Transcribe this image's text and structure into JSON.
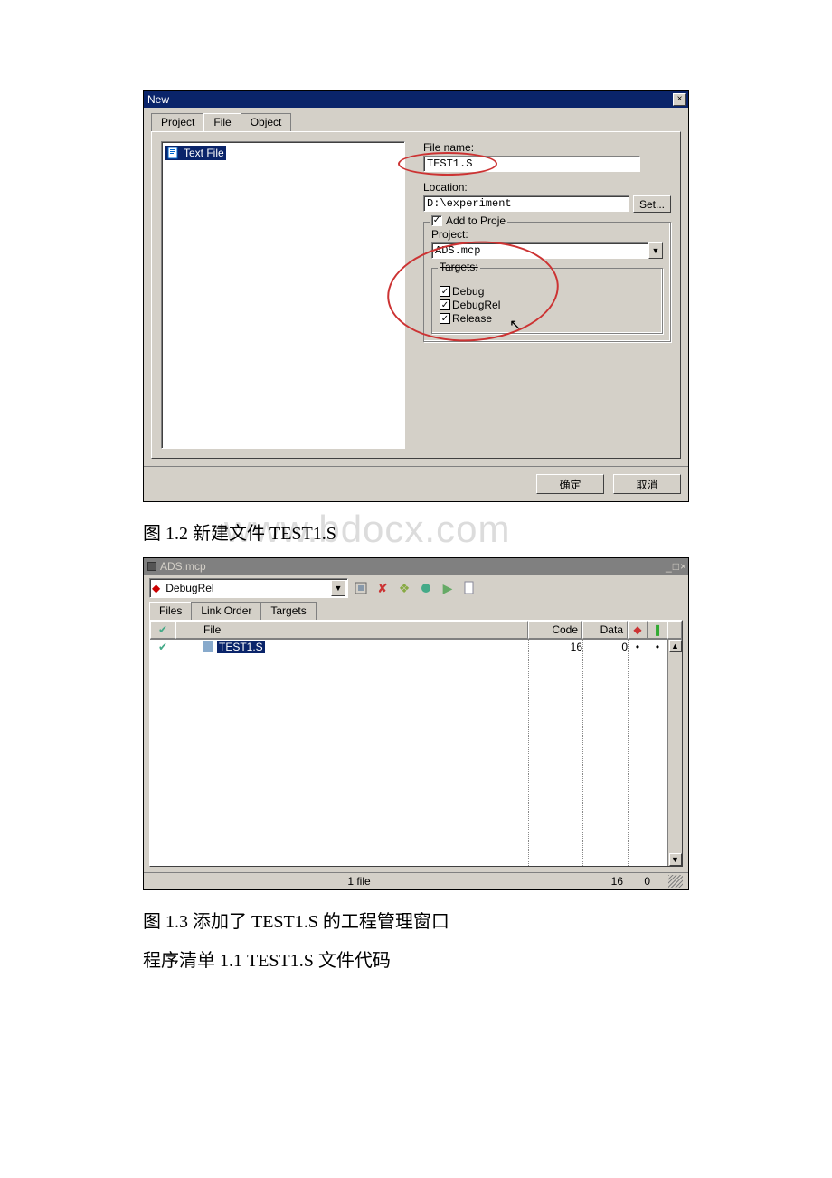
{
  "dialog1": {
    "title": "New",
    "tabs": [
      "Project",
      "File",
      "Object"
    ],
    "active_tab": 1,
    "list_item": "Text File",
    "file_name_label": "File name:",
    "file_name_value": "TEST1.S",
    "location_label": "Location:",
    "location_value": "D:\\experiment",
    "set_btn": "Set...",
    "add_to_proj_label": "Add to Proje",
    "project_label": "Project:",
    "project_value": "ADS.mcp",
    "targets_label": "Targets:",
    "targets": [
      "Debug",
      "DebugRel",
      "Release"
    ],
    "ok_btn": "确定",
    "cancel_btn": "取消"
  },
  "caption1": "图 1.2 新建文件 TEST1.S",
  "watermark": "www.bdocx.com",
  "win2": {
    "title": "ADS.mcp",
    "target_selected": "DebugRel",
    "tabs": [
      "Files",
      "Link Order",
      "Targets"
    ],
    "active_tab": 0,
    "columns": {
      "check": "✔",
      "file": "File",
      "code": "Code",
      "data": "Data"
    },
    "row": {
      "file": "TEST1.S",
      "code": "16",
      "data": "0"
    },
    "status": {
      "file_count": "1 file",
      "code_total": "16",
      "data_total": "0"
    }
  },
  "caption2": "图 1.3 添加了 TEST1.S 的工程管理窗口",
  "caption3": "程序清单 1.1 TEST1.S 文件代码"
}
